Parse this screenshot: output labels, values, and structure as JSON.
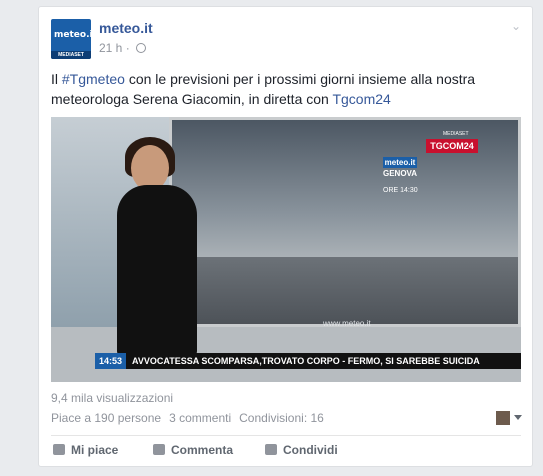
{
  "post": {
    "page_name": "meteo.it",
    "logo_text": "meteo.it",
    "logo_subtext": "MEDIASET",
    "timestamp": "21 h",
    "text_prefix": "Il ",
    "hashtag": "#Tgmeteo",
    "text_middle": " con le previsioni per i prossimi giorni insieme alla nostra meteorologa Serena Giacomin, in diretta con ",
    "mention": "Tgcom24"
  },
  "video": {
    "tag_meteo": "meteo.it",
    "tag_city": "GENOVA",
    "tag_time": "ORE 14:30",
    "tg_top": "MEDIASET",
    "tg_logo": "TGCOM24",
    "watermark": "www.meteo.it",
    "ticker_time": "14:53",
    "ticker_text": "AVVOCATESSA SCOMPARSA,TROVATO CORPO - FERMO, SI SAREBBE SUICIDA"
  },
  "stats": {
    "views": "9,4 mila visualizzazioni",
    "likes": "Piace a 190 persone",
    "comments": "3 commenti",
    "shares": "Condivisioni: 16"
  },
  "actions": {
    "like": "Mi piace",
    "comment": "Commenta",
    "share": "Condividi"
  }
}
